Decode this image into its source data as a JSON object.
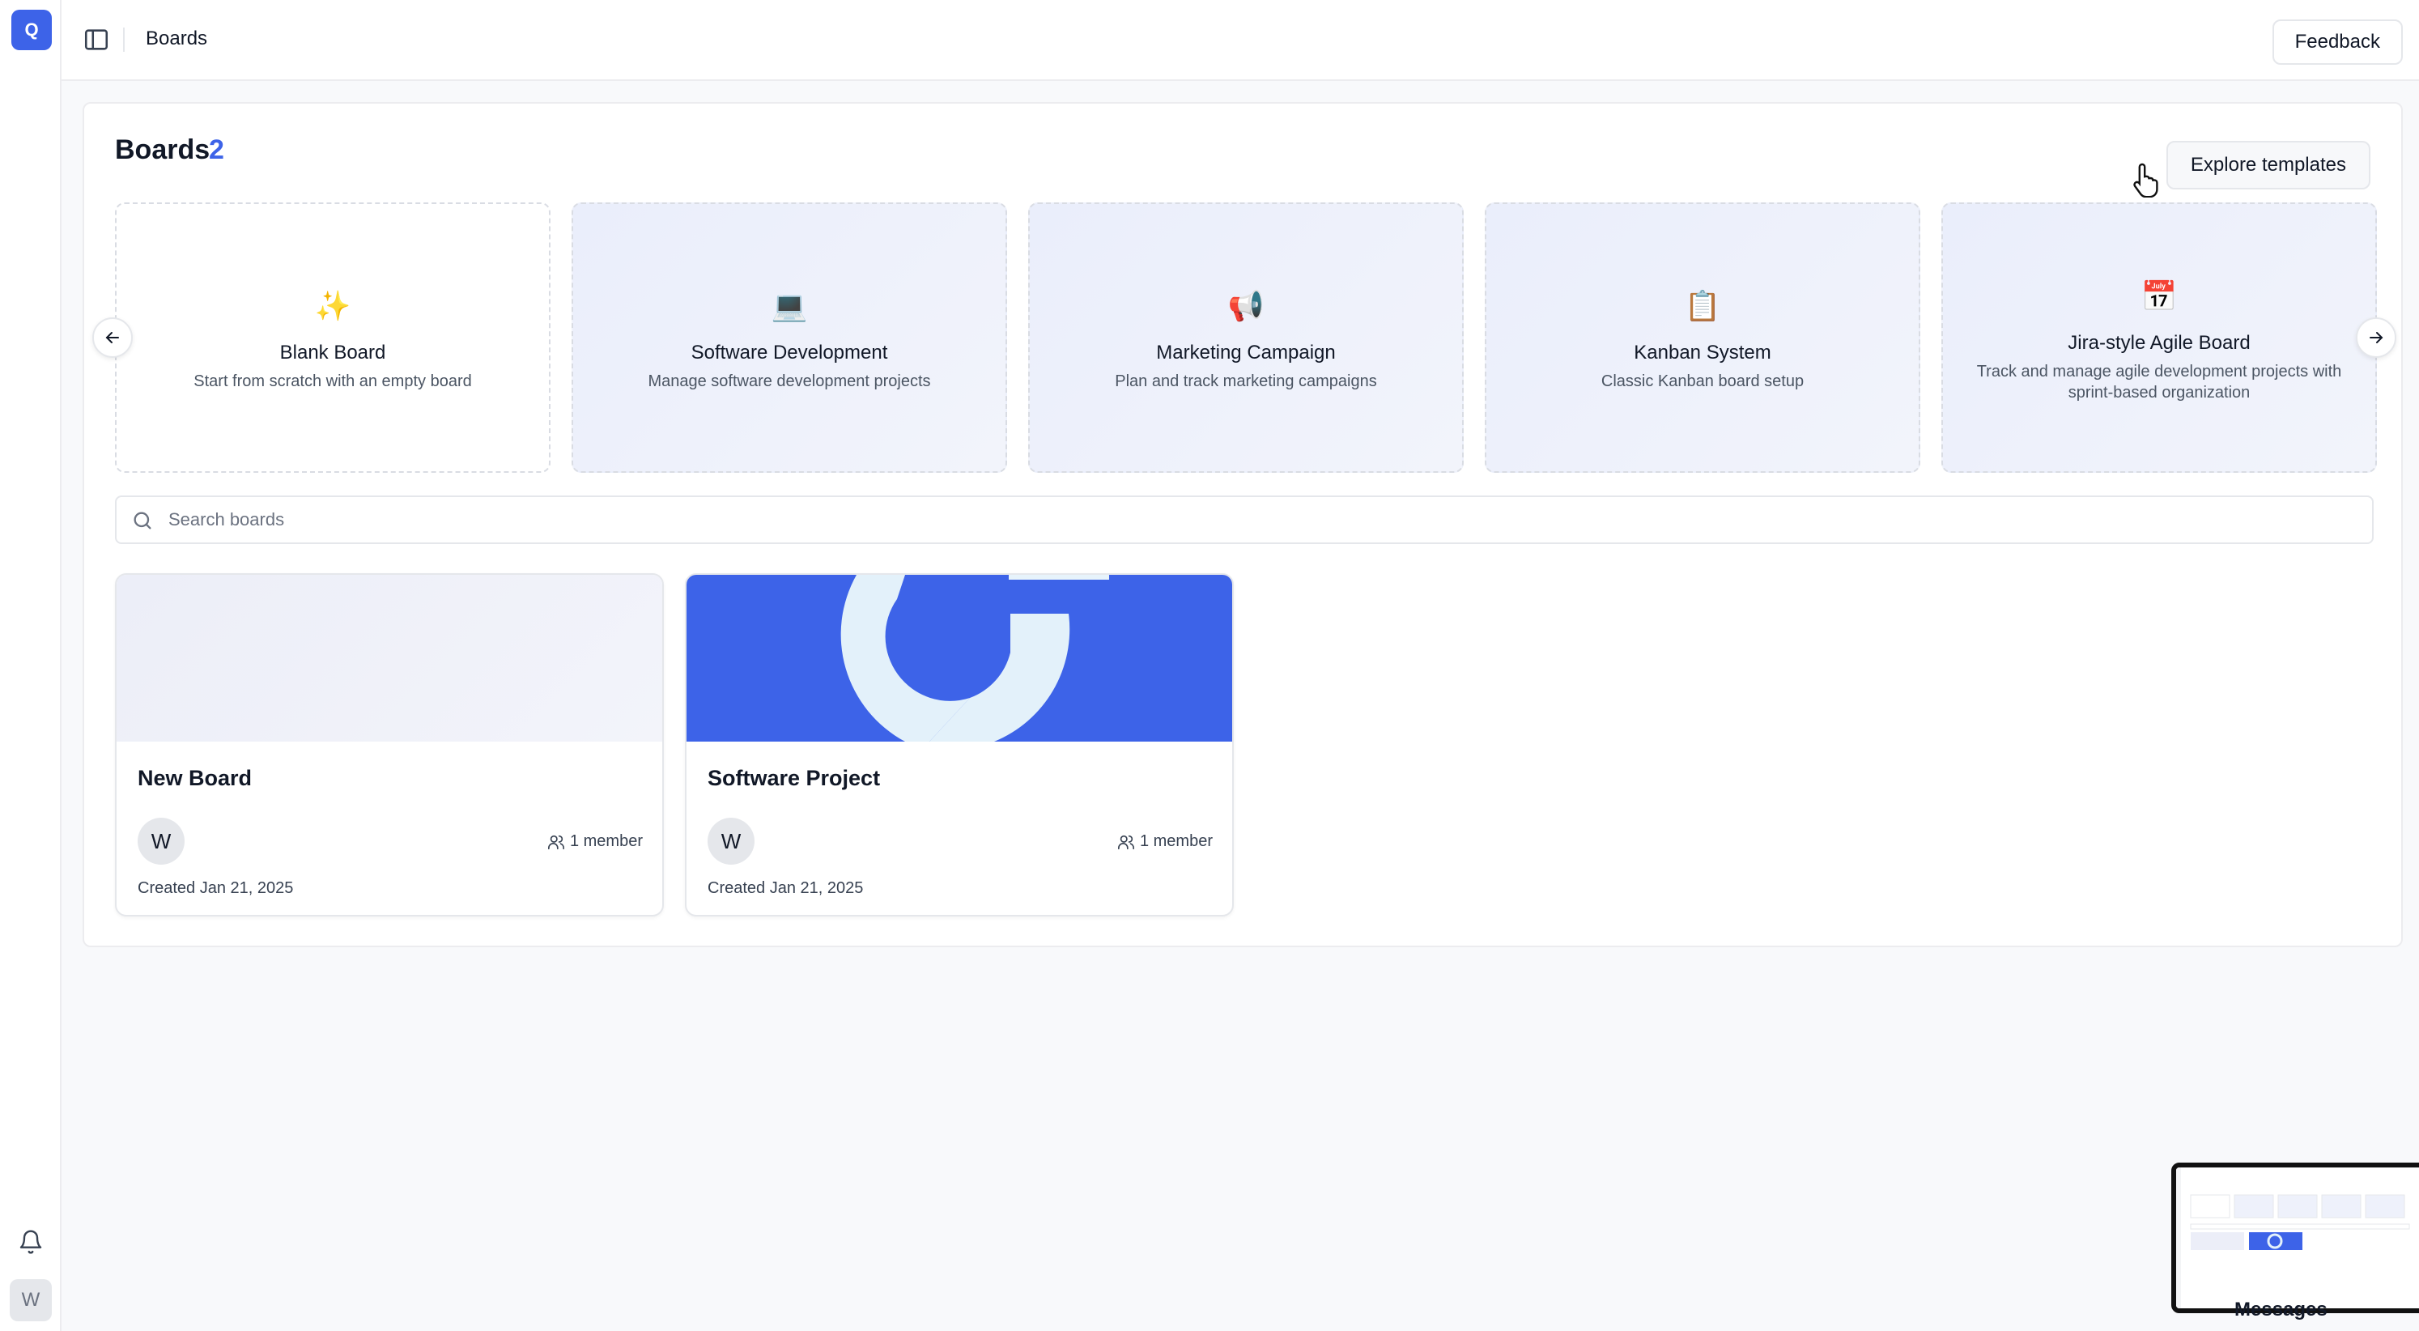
{
  "app": {
    "logo_letter": "Q",
    "user_initial": "W"
  },
  "header": {
    "breadcrumb": "Boards",
    "feedback_label": "Feedback"
  },
  "page": {
    "title": "Boards",
    "count": "2",
    "explore_label": "Explore templates"
  },
  "templates": [
    {
      "icon": "✨",
      "icon_name": "sparkles-icon",
      "title": "Blank Board",
      "description": "Start from scratch with an empty board"
    },
    {
      "icon": "💻",
      "icon_name": "laptop-icon",
      "title": "Software Development",
      "description": "Manage software development projects"
    },
    {
      "icon": "📢",
      "icon_name": "megaphone-icon",
      "title": "Marketing Campaign",
      "description": "Plan and track marketing campaigns"
    },
    {
      "icon": "📋",
      "icon_name": "clipboard-icon",
      "title": "Kanban System",
      "description": "Classic Kanban board setup"
    },
    {
      "icon": "📅",
      "icon_name": "calendar-icon",
      "title": "Jira-style Agile Board",
      "description": "Track and manage agile development projects with sprint-based organization"
    }
  ],
  "search": {
    "placeholder": "Search boards",
    "value": ""
  },
  "boards": [
    {
      "title": "New Board",
      "owner_initial": "W",
      "members": "1 member",
      "created": "Created Jan 21, 2025"
    },
    {
      "title": "Software Project",
      "owner_initial": "W",
      "members": "1 member",
      "created": "Created Jan 21, 2025"
    }
  ],
  "widgets": {
    "messages_label": "Messages"
  },
  "colors": {
    "accent": "#3d63e8",
    "border": "#e5e7eb",
    "muted_text": "#4b5563"
  }
}
